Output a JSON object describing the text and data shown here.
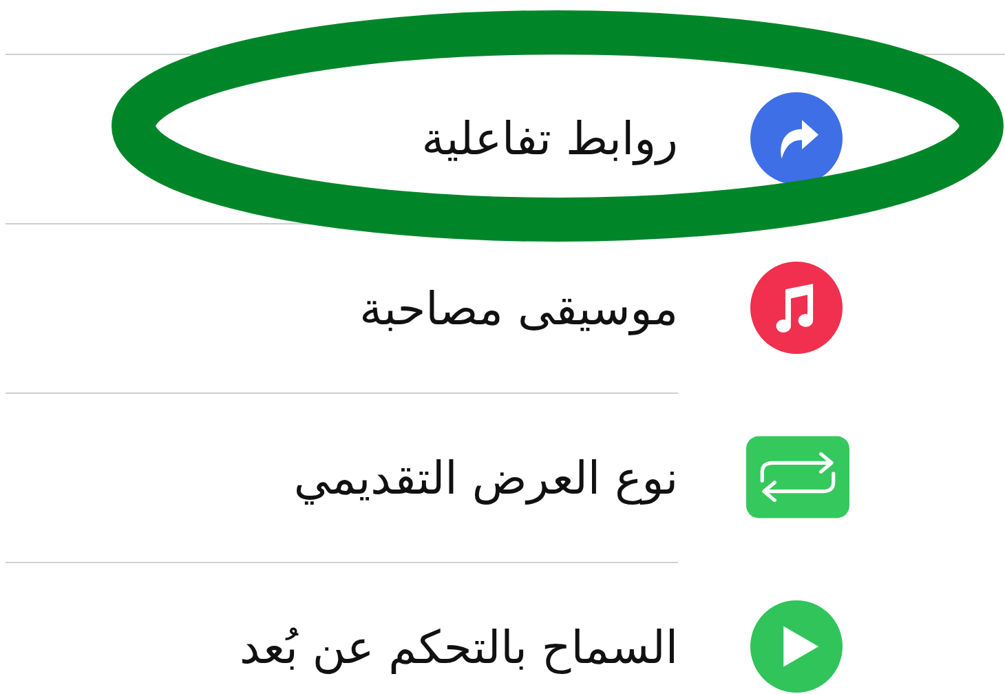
{
  "rows": [
    {
      "label": "روابط تفاعلية",
      "kind": "link",
      "color": "#3e6fe6",
      "highlighted": true
    },
    {
      "label": "موسيقى مصاحبة",
      "kind": "music",
      "color": "#f0304e",
      "highlighted": false
    },
    {
      "label": "نوع العرض التقديمي",
      "kind": "loop",
      "color": "#35c85d",
      "highlighted": false
    },
    {
      "label": "السماح بالتحكم عن بُعد",
      "kind": "play",
      "color": "#30c45a",
      "highlighted": false
    }
  ]
}
